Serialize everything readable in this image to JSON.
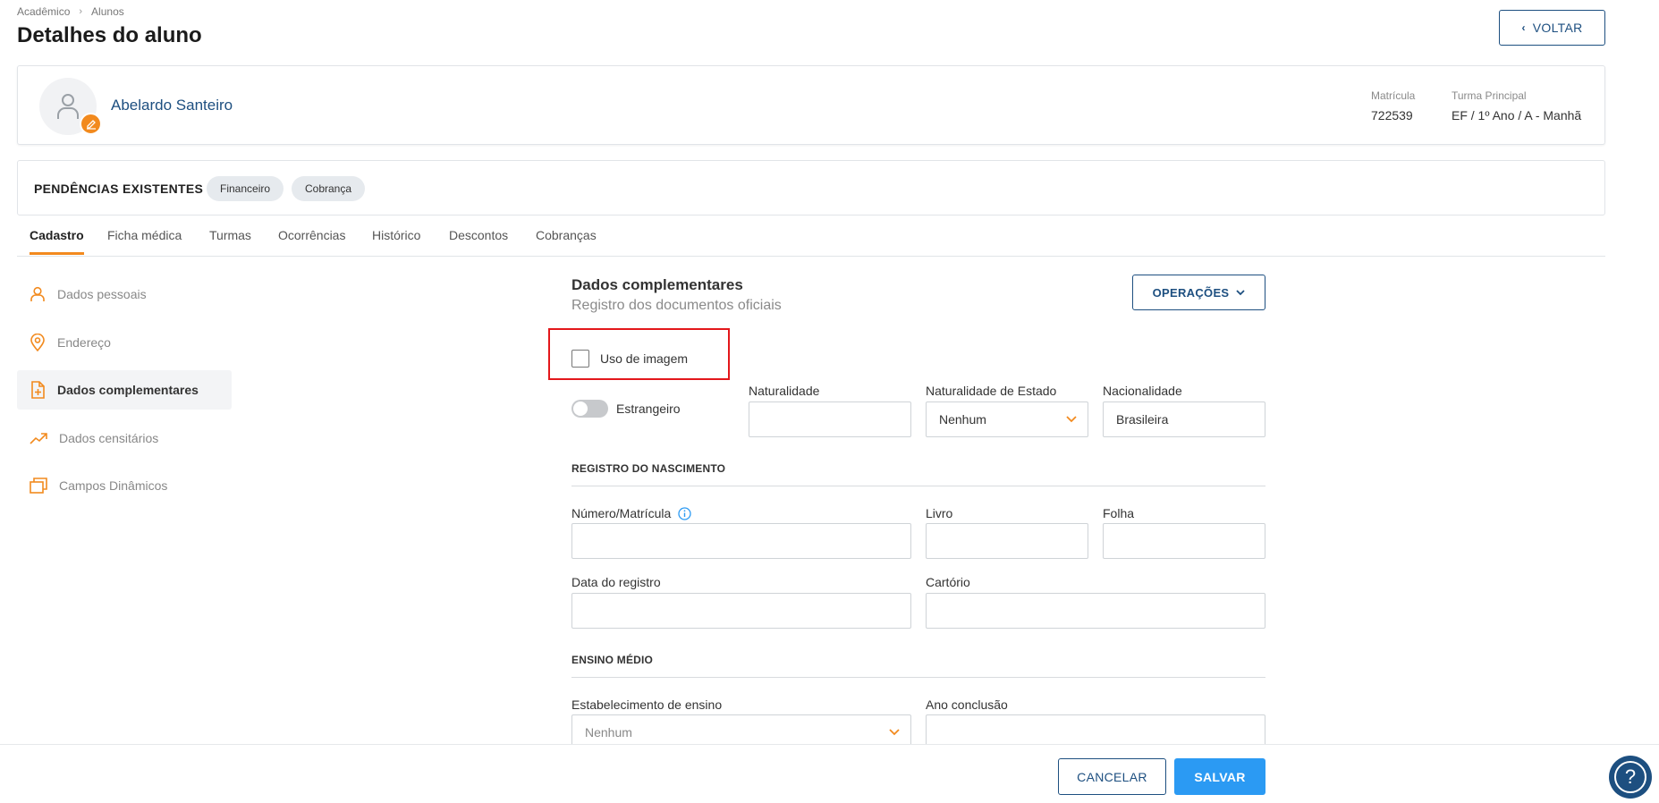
{
  "breadcrumb": {
    "root": "Acadêmico",
    "current": "Alunos"
  },
  "page": {
    "title": "Detalhes do aluno"
  },
  "back_button": {
    "label": "VOLTAR"
  },
  "student": {
    "name": "Abelardo Santeiro",
    "matricula_label": "Matrícula",
    "matricula_value": "722539",
    "turma_label": "Turma Principal",
    "turma_value": "EF / 1º Ano / A - Manhã"
  },
  "pendencias": {
    "title": "PENDÊNCIAS EXISTENTES",
    "chips": [
      "Financeiro",
      "Cobrança"
    ]
  },
  "tabs": [
    "Cadastro",
    "Ficha médica",
    "Turmas",
    "Ocorrências",
    "Histórico",
    "Descontos",
    "Cobranças"
  ],
  "active_tab": "Cadastro",
  "sidebar": {
    "items": [
      {
        "label": "Dados pessoais",
        "icon": "person-icon"
      },
      {
        "label": "Endereço",
        "icon": "location-pin-icon"
      },
      {
        "label": "Dados complementares",
        "icon": "document-plus-icon"
      },
      {
        "label": "Dados censitários",
        "icon": "trending-up-icon"
      },
      {
        "label": "Campos Dinâmicos",
        "icon": "stacked-windows-icon"
      }
    ],
    "active": "Dados complementares"
  },
  "section": {
    "title": "Dados complementares",
    "subtitle": "Registro dos documentos oficiais",
    "operations_label": "OPERAÇÕES"
  },
  "form": {
    "uso_imagem": {
      "label": "Uso de imagem",
      "checked": false
    },
    "estrangeiro": {
      "label": "Estrangeiro",
      "on": false
    },
    "naturalidade": {
      "label": "Naturalidade",
      "value": ""
    },
    "naturalidade_estado": {
      "label": "Naturalidade de Estado",
      "value": "Nenhum"
    },
    "nacionalidade": {
      "label": "Nacionalidade",
      "value": "Brasileira"
    },
    "registro_title": "REGISTRO DO NASCIMENTO",
    "numero_matricula": {
      "label": "Número/Matrícula",
      "value": ""
    },
    "livro": {
      "label": "Livro",
      "value": ""
    },
    "folha": {
      "label": "Folha",
      "value": ""
    },
    "data_registro": {
      "label": "Data do registro",
      "value": ""
    },
    "cartorio": {
      "label": "Cartório",
      "value": ""
    },
    "ensino_title": "ENSINO MÉDIO",
    "estabelecimento": {
      "label": "Estabelecimento de ensino",
      "value": "Nenhum"
    },
    "ano_conclusao": {
      "label": "Ano conclusão",
      "value": ""
    }
  },
  "footer": {
    "cancel_label": "CANCELAR",
    "save_label": "SALVAR",
    "help_icon": "question-mark-icon"
  },
  "colors": {
    "accent": "#f28a1e",
    "primary": "#1d4f80",
    "save": "#2b9af3",
    "highlight": "#e3171b"
  }
}
